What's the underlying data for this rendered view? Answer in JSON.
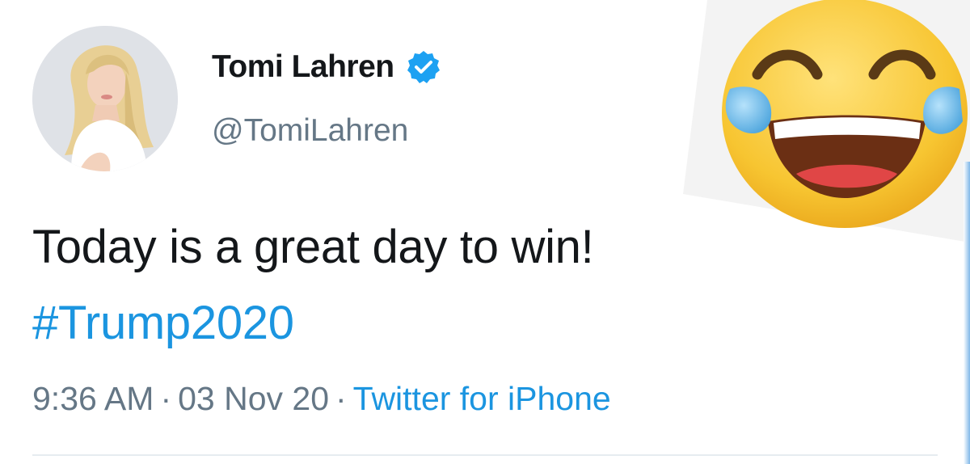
{
  "tweet": {
    "author": {
      "name": "Tomi Lahren",
      "handle": "@TomiLahren",
      "verified": true,
      "verified_icon": "verified-badge-icon"
    },
    "text": "Today is a great day to win!",
    "hashtag": "#Trump2020",
    "meta": {
      "time": "9:36 AM",
      "separator": "·",
      "date": "03 Nov 20",
      "source": "Twitter for iPhone"
    }
  },
  "overlay": {
    "emoji": "face-with-tears-of-joy-icon"
  },
  "colors": {
    "text_primary": "#14171a",
    "text_secondary": "#657786",
    "link_blue": "#1b95e0",
    "verified_blue": "#1da1f2",
    "emoji_yellow": "#f7c531",
    "tear_blue": "#5fb6e8"
  }
}
